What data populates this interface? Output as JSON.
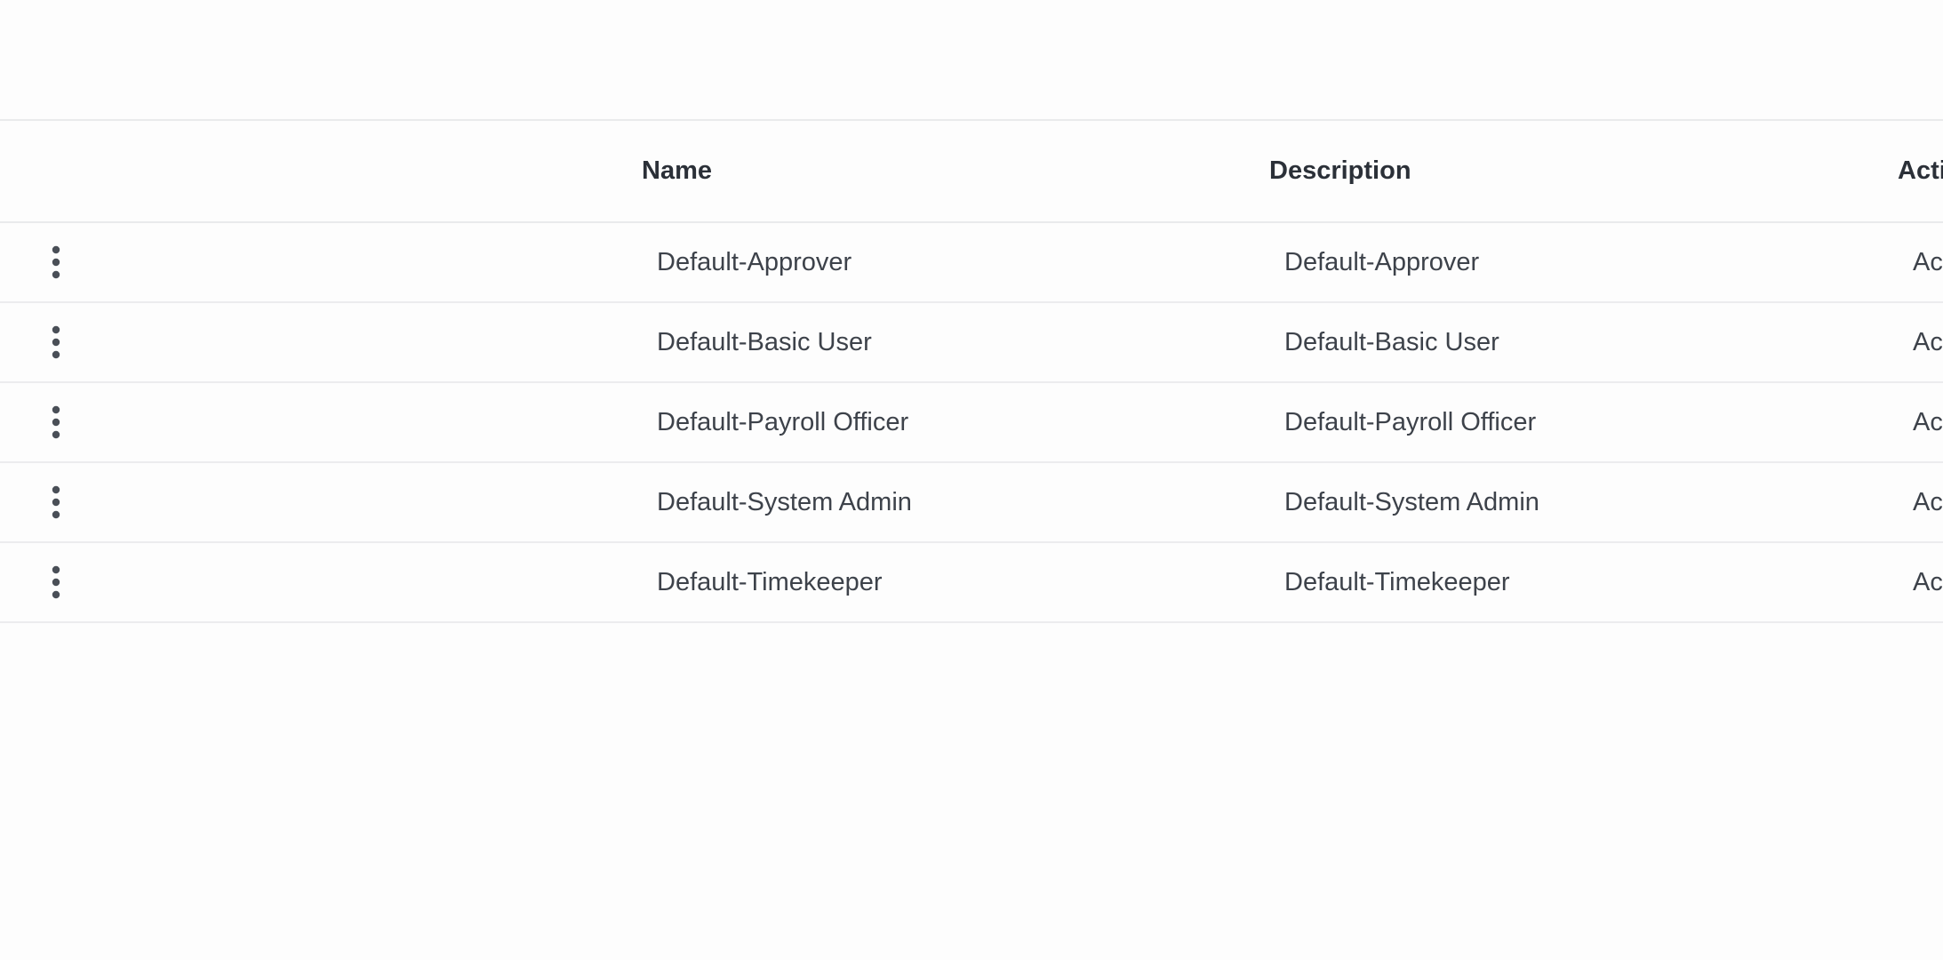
{
  "table": {
    "columns": {
      "name": "Name",
      "description": "Description",
      "status": "Acti"
    },
    "rows": [
      {
        "name": "Default-Approver",
        "description": "Default-Approver",
        "status": "Ac"
      },
      {
        "name": "Default-Basic User",
        "description": "Default-Basic User",
        "status": "Ac"
      },
      {
        "name": "Default-Payroll Officer",
        "description": "Default-Payroll Officer",
        "status": "Ac"
      },
      {
        "name": "Default-System Admin",
        "description": "Default-System Admin",
        "status": "Ac"
      },
      {
        "name": "Default-Timekeeper",
        "description": "Default-Timekeeper",
        "status": "Ac"
      }
    ]
  },
  "icons": {
    "row_menu": "kebab-menu-icon"
  },
  "colors": {
    "background": "#fdfdfd",
    "border": "#e9eaec",
    "header_text": "#2b3038",
    "cell_text": "#3d424a",
    "icon": "#4a4f57"
  }
}
